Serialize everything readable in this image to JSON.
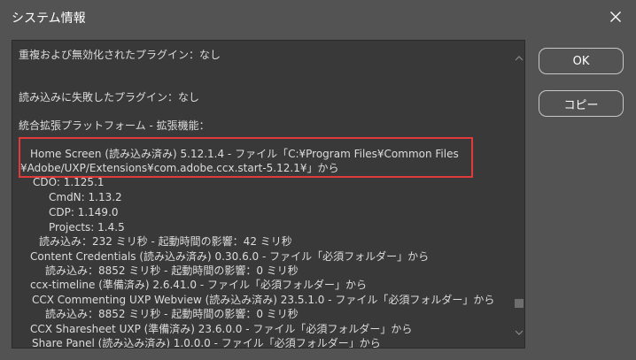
{
  "window": {
    "title": "システム情報",
    "close_icon": "close-icon"
  },
  "info_lines": [
    "重複および無効化されたプラグイン：なし",
    "読み込みに失敗したプラグイン：なし",
    "統合拡張プラットフォーム - 拡張機能：",
    "Home Screen (読み込み済み) 5.12.1.4 - ファイル「C:¥Program Files¥Common Files",
    "¥Adobe/UXP/Extensions¥com.adobe.ccx.start-5.12.1¥」から",
    "CDO: 1.125.1",
    "CmdN: 1.13.2",
    "CDP: 1.149.0",
    "Projects: 1.4.5",
    "読み込み：232 ミリ秒 - 起動時間の影響：42 ミリ秒",
    "Content Credentials (読み込み済み) 0.30.6.0 - ファイル「必須フォルダー」から",
    "読み込み：8852 ミリ秒 - 起動時間の影響：0 ミリ秒",
    "ccx-timeline (準備済み) 2.6.41.0 - ファイル「必須フォルダー」から",
    "CCX Commenting UXP Webview (読み込み済み) 23.5.1.0 - ファイル「必須フォルダー」から",
    "読み込み：8852 ミリ秒 - 起動時間の影響：0 ミリ秒",
    "CCX Sharesheet UXP (準備済み) 23.6.0.0 - ファイル「必須フォルダー」から",
    "Share Panel (読み込み済み) 1.0.0.0 - ファイル「必須フォルダー」から"
  ],
  "buttons": {
    "ok": "OK",
    "copy": "コピー"
  },
  "colors": {
    "background": "#535353",
    "text_area": "#393939",
    "highlight": "#e03a3a"
  }
}
